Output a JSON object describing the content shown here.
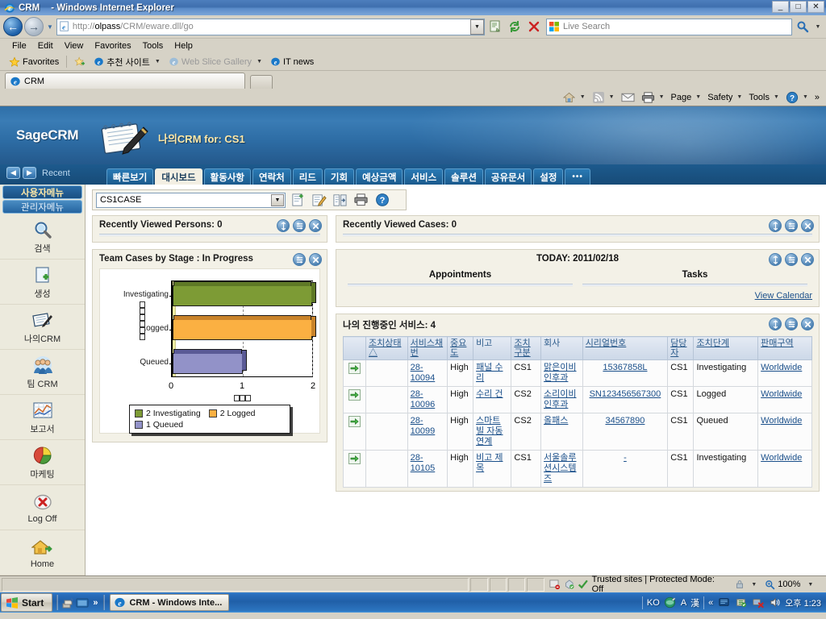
{
  "window": {
    "title": "CRM",
    "app_suffix": "- Windows Internet Explorer",
    "minimize": "_",
    "maximize": "□",
    "close": "✕"
  },
  "address_bar": {
    "url_protocol": "http://",
    "url_host": "olpass",
    "url_path": "/CRM/eware.dll/go",
    "search_placeholder": "Live Search",
    "back_icon": "back-arrow-icon",
    "forward_icon": "forward-arrow-icon",
    "dropdown_icon": "chevron-down-icon",
    "compat_icon": "compatibility-view-icon",
    "refresh_icon": "refresh-icon",
    "stop_icon": "stop-icon",
    "search_icon": "magnifier-icon"
  },
  "menu_bar": {
    "items": [
      "File",
      "Edit",
      "View",
      "Favorites",
      "Tools",
      "Help"
    ]
  },
  "favorites_bar": {
    "favorites_label": "Favorites",
    "items": [
      {
        "label": "추천 사이트",
        "has_caret": true,
        "dim": false
      },
      {
        "label": "Web Slice Gallery",
        "has_caret": true,
        "dim": true
      },
      {
        "label": "IT news",
        "has_caret": false,
        "dim": false
      }
    ]
  },
  "tab_strip": {
    "tabs": [
      {
        "label": "CRM"
      }
    ],
    "new_tab_label": ""
  },
  "command_bar": {
    "items": [
      {
        "label": "",
        "icon": "home-icon",
        "caret": true
      },
      {
        "label": "",
        "icon": "rss-feed-icon",
        "caret": true
      },
      {
        "label": "",
        "icon": "mail-icon",
        "caret": false
      },
      {
        "label": "",
        "icon": "printer-icon",
        "caret": true
      },
      {
        "label": "Page",
        "icon": "",
        "caret": true
      },
      {
        "label": "Safety",
        "icon": "",
        "caret": true
      },
      {
        "label": "Tools",
        "icon": "",
        "caret": true
      },
      {
        "label": "",
        "icon": "help-icon",
        "caret": true
      }
    ],
    "overflow": "»"
  },
  "crm_banner": {
    "logo_text": "SageCRM",
    "page_title": "나의CRM for: CS1",
    "icon": "notebook-pen-icon"
  },
  "crm_tabs": {
    "recent_label": "Recent",
    "back_icon": "left-arrow-icon",
    "forward_icon": "right-arrow-icon",
    "items": [
      {
        "label": "빠른보기",
        "active": false
      },
      {
        "label": "대시보드",
        "active": true
      },
      {
        "label": "활동사항",
        "active": false
      },
      {
        "label": "연락처",
        "active": false
      },
      {
        "label": "리드",
        "active": false
      },
      {
        "label": "기회",
        "active": false
      },
      {
        "label": "예상금액",
        "active": false
      },
      {
        "label": "서비스",
        "active": false
      },
      {
        "label": "솔루션",
        "active": false
      },
      {
        "label": "공유문서",
        "active": false
      },
      {
        "label": "설정",
        "active": false
      },
      {
        "label": "•••",
        "active": false
      }
    ]
  },
  "sidebar": {
    "menu_tabs": [
      {
        "label": "사용자메뉴",
        "selected": true
      },
      {
        "label": "관리자메뉴",
        "selected": false
      }
    ],
    "items": [
      {
        "label": "검색",
        "icon": "magnifier-icon"
      },
      {
        "label": "생성",
        "icon": "new-document-plus-icon"
      },
      {
        "label": "나의CRM",
        "icon": "notebook-pen-icon"
      },
      {
        "label": "팀 CRM",
        "icon": "people-group-icon"
      },
      {
        "label": "보고서",
        "icon": "chart-report-icon"
      },
      {
        "label": "마케팅",
        "icon": "pie-chart-icon"
      },
      {
        "label": "Log Off",
        "icon": "logoff-x-icon"
      },
      {
        "label": "Home",
        "icon": "home-arrow-icon"
      }
    ]
  },
  "toolbar": {
    "selected_case": "CS1CASE",
    "options": [
      "CS1CASE"
    ],
    "icons": [
      {
        "name": "new-dashboard-icon"
      },
      {
        "name": "edit-dashboard-icon"
      },
      {
        "name": "add-column-icon"
      },
      {
        "name": "print-icon"
      },
      {
        "name": "help-icon"
      }
    ]
  },
  "panels": {
    "recently_viewed_persons": {
      "title": "Recently Viewed Persons: 0",
      "icons": [
        "resize-icon",
        "settings-icon",
        "close-icon"
      ]
    },
    "recently_viewed_cases": {
      "title": "Recently Viewed Cases: 0",
      "icons": [
        "resize-icon",
        "settings-icon",
        "close-icon"
      ]
    },
    "today": {
      "title": "TODAY: 2011/02/18",
      "col_appointments": "Appointments",
      "col_tasks": "Tasks",
      "view_calendar": "View Calendar",
      "icons": [
        "resize-icon",
        "settings-icon",
        "close-icon"
      ]
    },
    "chart_panel": {
      "title": "Team Cases by Stage : In Progress",
      "icons": [
        "settings-icon",
        "close-icon"
      ]
    },
    "services": {
      "title": "나의 진행중인 서비스: 4",
      "icons": [
        "resize-icon",
        "settings-icon",
        "close-icon"
      ]
    }
  },
  "chart_data": {
    "type": "bar",
    "orientation": "horizontal",
    "title": "Team Cases by Stage : In Progress",
    "categories": [
      "Investigating",
      "Logged",
      "Queued"
    ],
    "values": [
      2,
      2,
      1
    ],
    "colors": [
      "#7d9b35",
      "#fbb042",
      "#9292c8"
    ],
    "xlabel": "□□□",
    "ylabel": "□□□□□□",
    "xlim": [
      0,
      2
    ],
    "xticks": [
      0,
      1,
      2
    ],
    "xticklabels": [
      "0",
      "1",
      "2"
    ],
    "grid": true,
    "legend_position": "bottom",
    "legend": [
      "2 Investigating",
      "2 Logged",
      "1 Queued"
    ]
  },
  "services_table": {
    "headers": [
      {
        "label": "조치상태 △",
        "link": true
      },
      {
        "label": "서비스채번",
        "link": true
      },
      {
        "label": "중요도",
        "link": true
      },
      {
        "label": "비고",
        "link": false
      },
      {
        "label": "조치구분",
        "link": true
      },
      {
        "label": "회사",
        "link": false
      },
      {
        "label": "시리얼번호",
        "link": true
      },
      {
        "label": "담당자",
        "link": true
      },
      {
        "label": "조치단계",
        "link": true
      },
      {
        "label": "판매구역",
        "link": true
      }
    ],
    "rows": [
      {
        "action": "go-arrow-icon",
        "case_no": "28-10094",
        "priority": "High",
        "note": "패널 수리",
        "type": "CS1",
        "company": "맑은이비인후과",
        "serial": "15367858L",
        "owner": "CS1",
        "stage": "Investigating",
        "territory": "Worldwide"
      },
      {
        "action": "go-arrow-icon",
        "case_no": "28-10096",
        "priority": "High",
        "note": "수리 건",
        "type": "CS2",
        "company": "소리이비인후과",
        "serial": "SN123456567300",
        "owner": "CS1",
        "stage": "Logged",
        "territory": "Worldwide"
      },
      {
        "action": "go-arrow-icon",
        "case_no": "28-10099",
        "priority": "High",
        "note": "스마트빌 자동 연계",
        "type": "CS2",
        "company": "올패스",
        "serial": "34567890",
        "owner": "CS1",
        "stage": "Queued",
        "territory": "Worldwide"
      },
      {
        "action": "go-arrow-icon",
        "case_no": "28-10105",
        "priority": "High",
        "note": "비고 제목",
        "type": "CS1",
        "company": "서울솔루션시스템즈",
        "serial": "-",
        "owner": "CS1",
        "stage": "Investigating",
        "territory": "Worldwide"
      }
    ]
  },
  "status_bar": {
    "zone": "Trusted sites | Protected Mode: Off",
    "zoom": "100%",
    "check_icon": "checkmark-icon",
    "lock_icon": "lock-icon",
    "zoom_icon": "zoom-icon"
  },
  "taskbar": {
    "start_label": "Start",
    "quick_launch": [
      "show-desktop-icon",
      "switch-window-icon"
    ],
    "overflow_chevron": "»",
    "task_title": "CRM   - Windows Inte...",
    "tray": {
      "lang": "KO",
      "ime_alpha": "A",
      "ime_hanja": "漢",
      "collapse": "«",
      "clock": "오후 1:23"
    }
  }
}
